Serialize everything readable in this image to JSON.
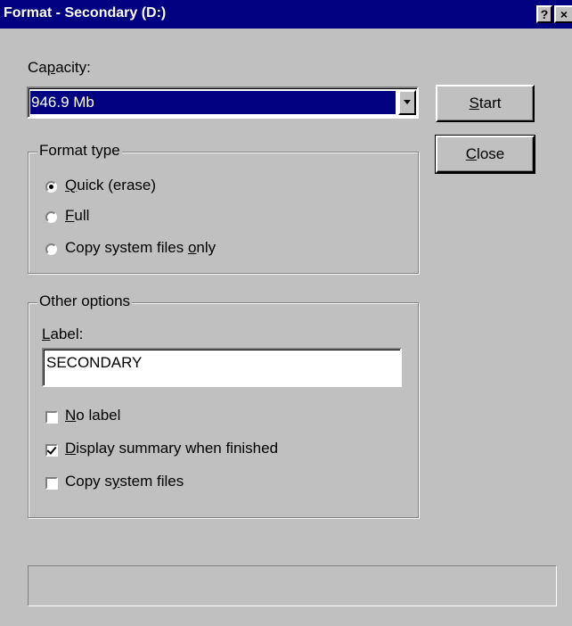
{
  "window": {
    "title": "Format - Secondary (D:)",
    "help_button": "?",
    "close_button": "×"
  },
  "capacity": {
    "label_pre": "Ca",
    "label_key": "p",
    "label_post": "acity:",
    "selected": "946.9 Mb"
  },
  "buttons": {
    "start": {
      "key": "S",
      "rest": "tart"
    },
    "close": {
      "key": "C",
      "rest": "lose"
    }
  },
  "format_type": {
    "legend": "Format type",
    "options": [
      {
        "pre": "",
        "key": "Q",
        "post": "uick (erase)",
        "checked": true
      },
      {
        "pre": "",
        "key": "F",
        "post": "ull",
        "checked": false
      },
      {
        "pre": "Copy system files ",
        "key": "o",
        "post": "nly",
        "checked": false
      }
    ]
  },
  "other_options": {
    "legend": "Other options",
    "label_field": {
      "key": "L",
      "rest": "abel:",
      "value": "SECONDARY"
    },
    "checkboxes": [
      {
        "pre": "",
        "key": "N",
        "post": "o label",
        "checked": false
      },
      {
        "pre": "",
        "key": "D",
        "post": "isplay summary when finished",
        "checked": true
      },
      {
        "pre": "Copy s",
        "key": "y",
        "post": "stem files",
        "checked": false
      }
    ]
  },
  "progress": {
    "fraction": 0
  },
  "colors": {
    "titlebar": "#000080",
    "face": "#c0c0c0",
    "highlight": "#000080"
  }
}
